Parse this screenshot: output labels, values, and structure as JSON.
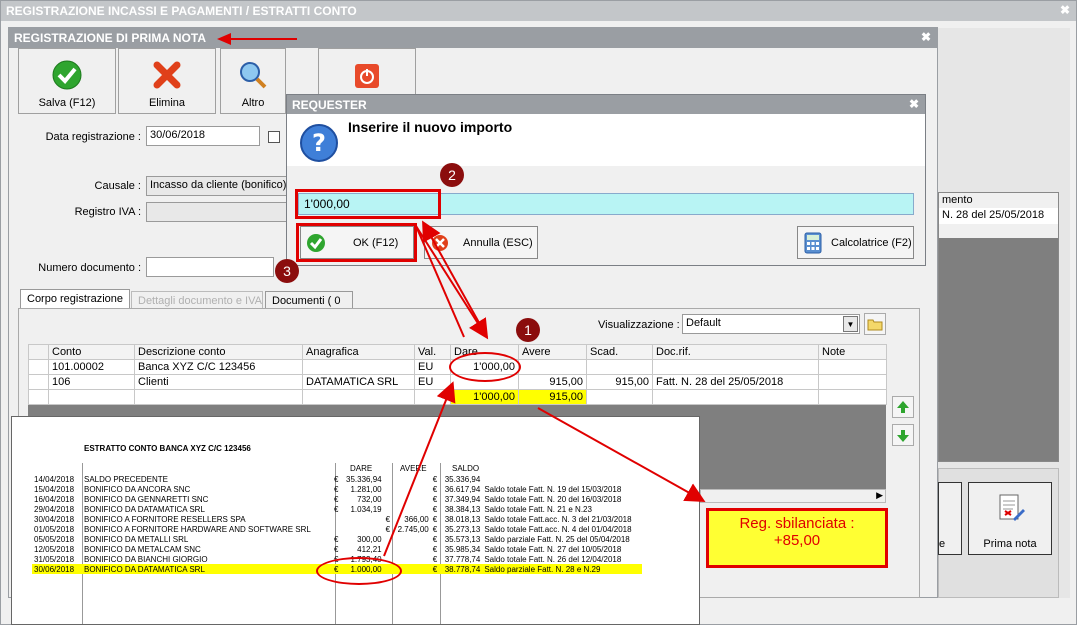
{
  "outer_window": {
    "title": "REGISTRAZIONE INCASSI E PAGAMENTI / ESTRATTI CONTO"
  },
  "inner_window": {
    "title": "REGISTRAZIONE DI PRIMA NOTA"
  },
  "toolbar": {
    "save": "Salva (F12)",
    "delete": "Elimina",
    "other": "Altro"
  },
  "form": {
    "date_label": "Data registrazione :",
    "date_value": "30/06/2018",
    "causale_label": "Causale :",
    "causale_value": "Incasso da cliente (bonifico)",
    "registro_label": "Registro IVA :",
    "numero_label": "Numero documento :"
  },
  "tabs": [
    "Corpo registrazione",
    "Dettagli documento e IVA",
    "Documenti ( 0 )"
  ],
  "visualizzazione": {
    "label": "Visualizzazione :",
    "value": "Default"
  },
  "grid": {
    "headers": [
      "Conto",
      "Descrizione conto",
      "Anagrafica",
      "Val.",
      "Dare",
      "Avere",
      "Scad.",
      "Doc.rif.",
      "Note"
    ],
    "rows": [
      [
        "101.00002",
        "Banca XYZ C/C 123456",
        "",
        "EU",
        "1'000,00",
        "",
        "",
        "",
        ""
      ],
      [
        "106",
        "Clienti",
        "DATAMATICA SRL",
        "EU",
        "",
        "915,00",
        "915,00",
        "Fatt. N. 28 del 25/05/2018",
        ""
      ]
    ],
    "totals": {
      "dare": "1'000,00",
      "avere": "915,00"
    }
  },
  "right_panel": {
    "header": "mento",
    "value": "N. 28 del 25/05/2018",
    "prima_nota": "Prima nota",
    "partial": "e"
  },
  "requester": {
    "title": "REQUESTER",
    "message": "Inserire il nuovo importo",
    "input_value": "1'000,00",
    "ok": "OK (F12)",
    "cancel": "Annulla (ESC)",
    "calc": "Calcolatrice (F2)"
  },
  "annotations": {
    "step1": "1",
    "step2": "2",
    "step3": "3",
    "unbalanced_line1": "Reg. sbilanciata :",
    "unbalanced_line2": "+85,00"
  },
  "statement": {
    "title": "ESTRATTO CONTO BANCA XYZ C/C 123456",
    "headers": [
      "DARE",
      "AVERE",
      "SALDO"
    ],
    "rows": [
      [
        "14/04/2018",
        "SALDO PRECEDENTE",
        "€",
        "35.336,94",
        "",
        "",
        "€",
        "35.336,94",
        ""
      ],
      [
        "15/04/2018",
        "BONIFICO DA ANCORA SNC",
        "€",
        "1.281,00",
        "",
        "",
        "€",
        "36.617,94",
        "Saldo totale Fatt. N. 19 del 15/03/2018"
      ],
      [
        "16/04/2018",
        "BONIFICO DA GENNARETTI SNC",
        "€",
        "732,00",
        "",
        "",
        "€",
        "37.349,94",
        "Saldo totale Fatt. N. 20 del 16/03/2018"
      ],
      [
        "29/04/2018",
        "BONIFICO DA DATAMATICA SRL",
        "€",
        "1.034,19",
        "",
        "",
        "€",
        "38.384,13",
        "Saldo totale Fatt. N. 21 e N.23"
      ],
      [
        "30/04/2018",
        "BONIFICO A FORNITORE RESELLERS SPA",
        "",
        "",
        "€",
        "366,00",
        "€",
        "38.018,13",
        "Saldo totale Fatt.acc. N. 3 del 21/03/2018"
      ],
      [
        "01/05/2018",
        "BONIFICO A FORNITORE HARDWARE AND SOFTWARE SRL",
        "",
        "",
        "€",
        "2.745,00",
        "€",
        "35.273,13",
        "Saldo totale Fatt.acc. N. 4 del 01/04/2018"
      ],
      [
        "05/05/2018",
        "BONIFICO DA METALLI SRL",
        "€",
        "300,00",
        "",
        "",
        "€",
        "35.573,13",
        "Saldo parziale Fatt. N. 25 del 05/04/2018"
      ],
      [
        "12/05/2018",
        "BONIFICO DA METALCAM SNC",
        "€",
        "412,21",
        "",
        "",
        "€",
        "35.985,34",
        "Saldo totale Fatt. N. 27 del 10/05/2018"
      ],
      [
        "31/05/2018",
        "BONIFICO DA BIANCHI GIORGIO",
        "€",
        "1.793,40",
        "",
        "",
        "€",
        "37.778,74",
        "Saldo totale Fatt. N. 26 del 12/04/2018"
      ],
      [
        "30/06/2018",
        "BONIFICO DA DATAMATICA SRL",
        "€",
        "1.000,00",
        "",
        "",
        "€",
        "38.778,74",
        "Saldo parziale Fatt. N. 28 e N.29"
      ]
    ]
  }
}
